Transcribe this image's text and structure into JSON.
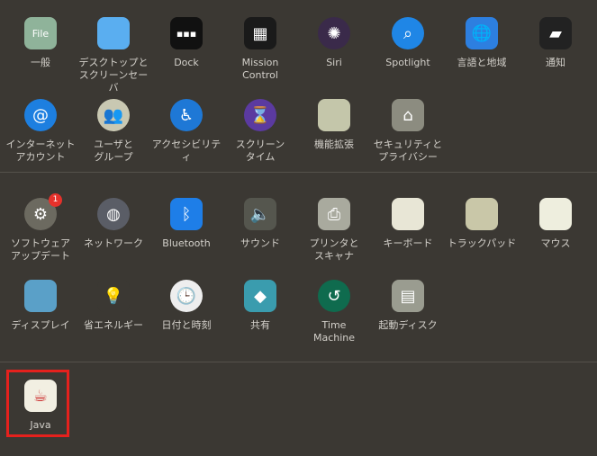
{
  "sections": [
    {
      "rows": [
        [
          {
            "id": "general",
            "label": "一般",
            "icon": "general-icon",
            "color": "#8fb39a",
            "glyph": "File"
          },
          {
            "id": "desktop",
            "label": "デスクトップと\nスクリーンセーバ",
            "icon": "desktop-screensaver-icon",
            "color": "#5aaef0",
            "glyph": ""
          },
          {
            "id": "dock",
            "label": "Dock",
            "icon": "dock-icon",
            "color": "#111111",
            "glyph": "▪▪▪"
          },
          {
            "id": "mission-control",
            "label": "Mission\nControl",
            "icon": "mission-control-icon",
            "color": "#1a1a1a",
            "glyph": "▦"
          },
          {
            "id": "siri",
            "label": "Siri",
            "icon": "siri-icon",
            "color": "#3a2a4a",
            "glyph": "✺",
            "round": true
          },
          {
            "id": "spotlight",
            "label": "Spotlight",
            "icon": "spotlight-icon",
            "color": "#1f86e6",
            "glyph": "⌕",
            "round": true
          },
          {
            "id": "language",
            "label": "言語と地域",
            "icon": "language-region-icon",
            "color": "#2d7fe0",
            "glyph": "🌐"
          },
          {
            "id": "notifications",
            "label": "通知",
            "icon": "notifications-icon",
            "color": "#222222",
            "glyph": "▰"
          }
        ],
        [
          {
            "id": "internet-accounts",
            "label": "インターネット\nアカウント",
            "icon": "internet-accounts-icon",
            "color": "#1d7fe0",
            "glyph": "@",
            "round": true
          },
          {
            "id": "users",
            "label": "ユーザと\nグループ",
            "icon": "users-groups-icon",
            "color": "#c9c8b2",
            "glyph": "👥",
            "round": true
          },
          {
            "id": "accessibility",
            "label": "アクセシビリティ",
            "icon": "accessibility-icon",
            "color": "#1e78d6",
            "glyph": "♿",
            "round": true
          },
          {
            "id": "screen-time",
            "label": "スクリーン\nタイム",
            "icon": "screen-time-icon",
            "color": "#5b3aa0",
            "glyph": "⌛",
            "round": true
          },
          {
            "id": "extensions",
            "label": "機能拡張",
            "icon": "extensions-icon",
            "color": "#c4c6aa",
            "glyph": ""
          },
          {
            "id": "security",
            "label": "セキュリティと\nプライバシー",
            "icon": "security-privacy-icon",
            "color": "#8c8c80",
            "glyph": "⌂"
          }
        ]
      ]
    },
    {
      "rows": [
        [
          {
            "id": "software-update",
            "label": "ソフトウェア\nアップデート",
            "icon": "software-update-gear-icon",
            "color": "#6c6a60",
            "glyph": "⚙",
            "round": true,
            "badge": "1"
          },
          {
            "id": "network",
            "label": "ネットワーク",
            "icon": "network-globe-icon",
            "color": "#5a5d66",
            "glyph": "◍",
            "round": true
          },
          {
            "id": "bluetooth",
            "label": "Bluetooth",
            "icon": "bluetooth-icon",
            "color": "#1e7ee8",
            "glyph": "ᛒ"
          },
          {
            "id": "sound",
            "label": "サウンド",
            "icon": "speaker-icon",
            "color": "#55564e",
            "glyph": "🔈"
          },
          {
            "id": "printers",
            "label": "プリンタと\nスキャナ",
            "icon": "printer-icon",
            "color": "#a9aa9e",
            "glyph": "⎙"
          },
          {
            "id": "keyboard",
            "label": "キーボード",
            "icon": "keyboard-icon",
            "color": "#e8e6d6",
            "glyph": ""
          },
          {
            "id": "trackpad",
            "label": "トラックパッド",
            "icon": "trackpad-icon",
            "color": "#c9c7a8",
            "glyph": ""
          },
          {
            "id": "mouse",
            "label": "マウス",
            "icon": "mouse-icon",
            "color": "#eeeede",
            "glyph": ""
          }
        ],
        [
          {
            "id": "displays",
            "label": "ディスプレイ",
            "icon": "display-monitor-icon",
            "color": "#5aa0c8",
            "glyph": ""
          },
          {
            "id": "energy",
            "label": "省エネルギー",
            "icon": "lightbulb-icon",
            "color": "#3b3833",
            "glyph": "💡"
          },
          {
            "id": "date-time",
            "label": "日付と時刻",
            "icon": "clock-calendar-icon",
            "color": "#eeeeee",
            "glyph": "🕒",
            "round": true
          },
          {
            "id": "sharing",
            "label": "共有",
            "icon": "sharing-folder-icon",
            "color": "#3a9cae",
            "glyph": "◆"
          },
          {
            "id": "time-machine",
            "label": "Time\nMachine",
            "icon": "time-machine-icon",
            "color": "#0f6b4e",
            "glyph": "↺",
            "round": true
          },
          {
            "id": "startup-disk",
            "label": "起動ディスク",
            "icon": "startup-disk-icon",
            "color": "#9a9c90",
            "glyph": "▤"
          }
        ]
      ]
    },
    {
      "rows": [
        [
          {
            "id": "java",
            "label": "Java",
            "icon": "java-icon",
            "color": "#f2efe2",
            "glyph": "☕"
          }
        ]
      ]
    }
  ],
  "highlight_color": "#e5211d"
}
